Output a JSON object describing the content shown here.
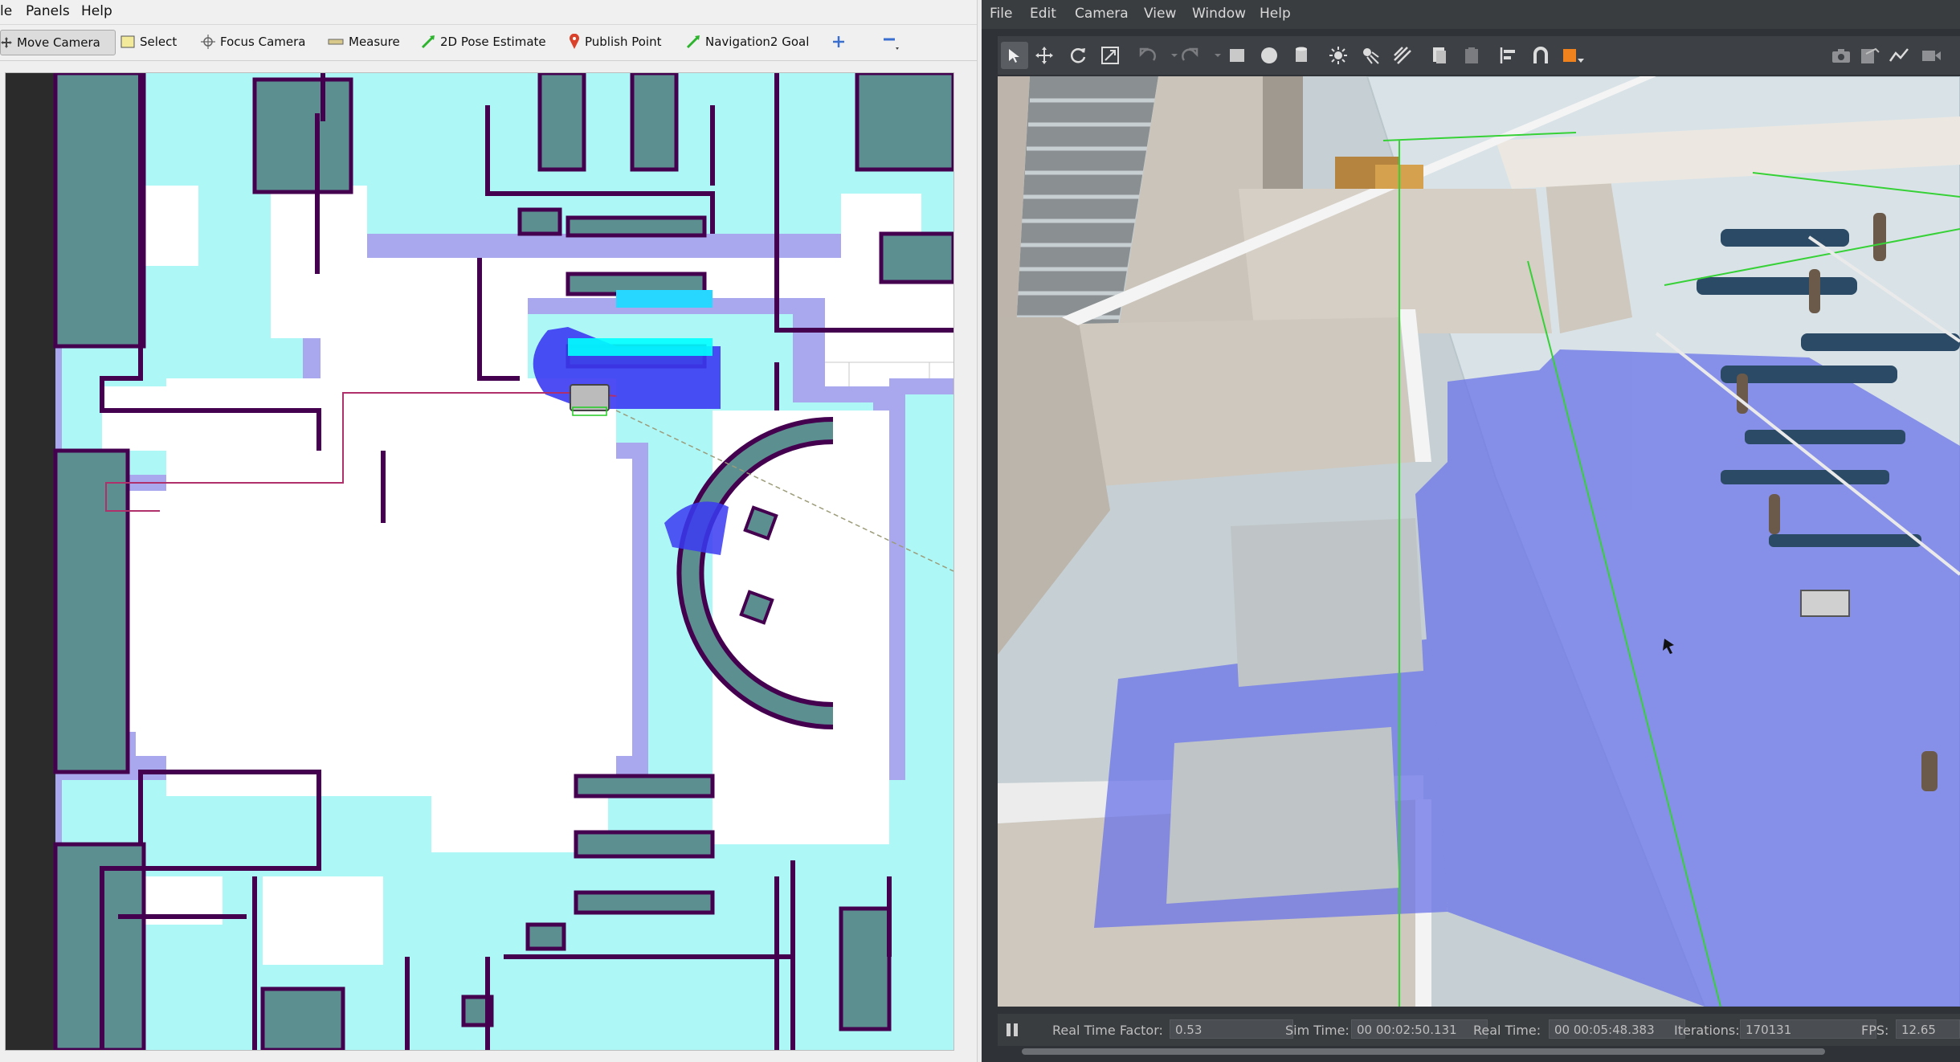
{
  "rviz": {
    "menu": [
      "le",
      "Panels",
      "Help"
    ],
    "tools": [
      {
        "label": "Move Camera",
        "icon": "move-camera-icon",
        "active": true
      },
      {
        "label": "Select",
        "icon": "select-icon"
      },
      {
        "label": "Focus Camera",
        "icon": "focus-camera-icon"
      },
      {
        "label": "Measure",
        "icon": "measure-icon"
      },
      {
        "label": "2D Pose Estimate",
        "icon": "pose-estimate-icon"
      },
      {
        "label": "Publish Point",
        "icon": "publish-point-icon"
      },
      {
        "label": "Navigation2 Goal",
        "icon": "nav-goal-icon"
      }
    ],
    "extra_tools": [
      "add-tool-icon",
      "remove-tool-icon"
    ],
    "colors": {
      "costmap_inflation": "#a9a8ee",
      "costmap_inscribed": "#aef7f7",
      "obstacle": "#44004f",
      "occupied_fill": "#5c8f90",
      "path": "#b0306b"
    }
  },
  "gazebo": {
    "menu": [
      "File",
      "Edit",
      "Camera",
      "View",
      "Window",
      "Help"
    ],
    "toolbar_icons": [
      "select-mode-icon",
      "translate-icon",
      "rotate-icon",
      "scale-icon",
      "undo-icon",
      "redo-icon",
      "box-icon",
      "sphere-icon",
      "cylinder-icon",
      "point-light-icon",
      "spot-light-icon",
      "directional-light-icon",
      "copy-icon",
      "paste-icon",
      "align-icon",
      "snap-icon",
      "color-icon",
      "screenshot-icon",
      "record-icon",
      "plot-icon",
      "video-icon"
    ],
    "status": {
      "real_time_factor_label": "Real Time Factor:",
      "real_time_factor": "0.53",
      "sim_time_label": "Sim Time:",
      "sim_time": "00 00:02:50.131",
      "real_time_label": "Real Time:",
      "real_time": "00 00:05:48.383",
      "iterations_label": "Iterations:",
      "iterations": "170131",
      "fps_label": "FPS:",
      "fps": "12.65"
    }
  }
}
